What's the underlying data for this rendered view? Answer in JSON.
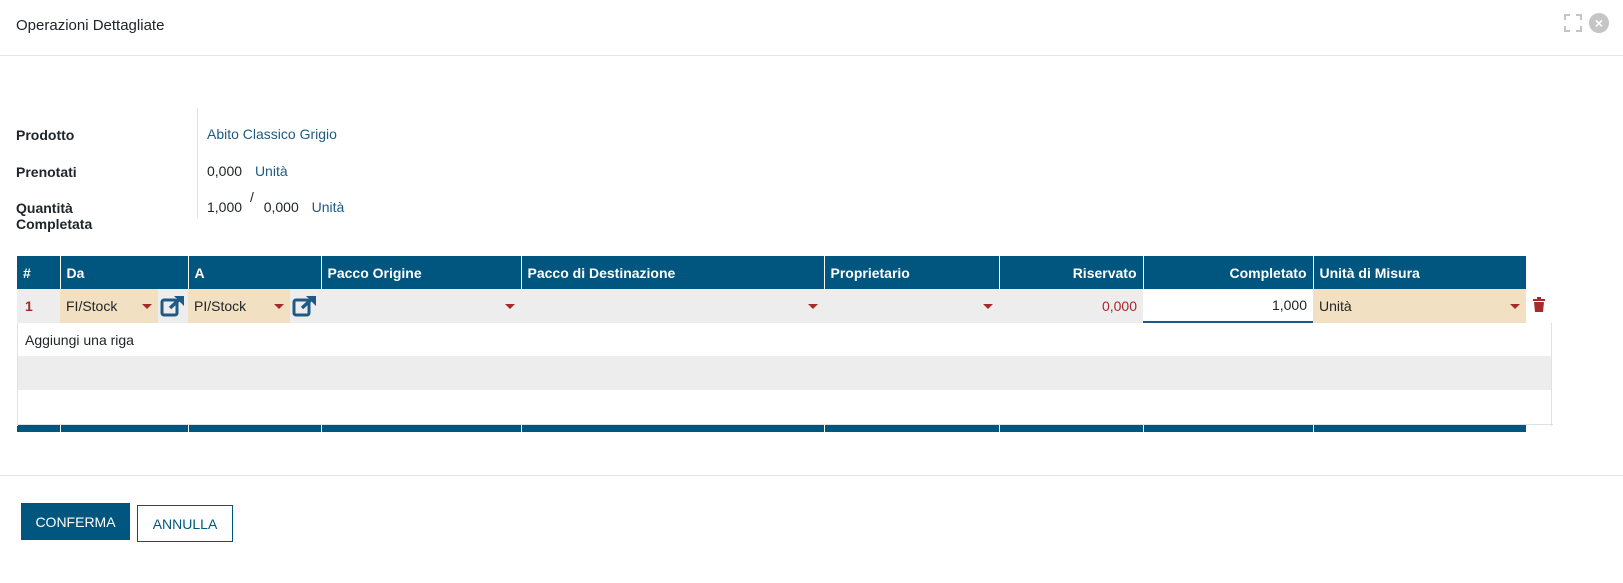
{
  "dialog": {
    "title": "Operazioni Dettagliate"
  },
  "info": {
    "product_label": "Prodotto",
    "product_value": "Abito Classico Grigio",
    "reserved_label": "Prenotati",
    "reserved_value": "0,000",
    "reserved_uom": "Unità",
    "done_label": "Quantità Completata",
    "done_value": "1,000",
    "done_separator": "/",
    "done_total": "0,000",
    "done_uom": "Unità"
  },
  "table": {
    "columns": [
      "#",
      "Da",
      "A",
      "Pacco Origine",
      "Pacco di Destinazione",
      "Proprietario",
      "Riservato",
      "Completato",
      "Unità di Misura"
    ],
    "rows": [
      {
        "num": "1",
        "from": "FI/Stock",
        "to": "PI/Stock",
        "source_package": "",
        "dest_package": "",
        "owner": "",
        "reserved": "0,000",
        "done": "1,000",
        "uom": "Unità"
      }
    ],
    "add_line": "Aggiungi una riga"
  },
  "footer": {
    "confirm": "CONFERMA",
    "cancel": "ANNULLA"
  },
  "colors": {
    "primary": "#00567f",
    "link": "#1e5a86",
    "accent_red": "#a52a2a",
    "required_bg": "#f2e0c2"
  }
}
